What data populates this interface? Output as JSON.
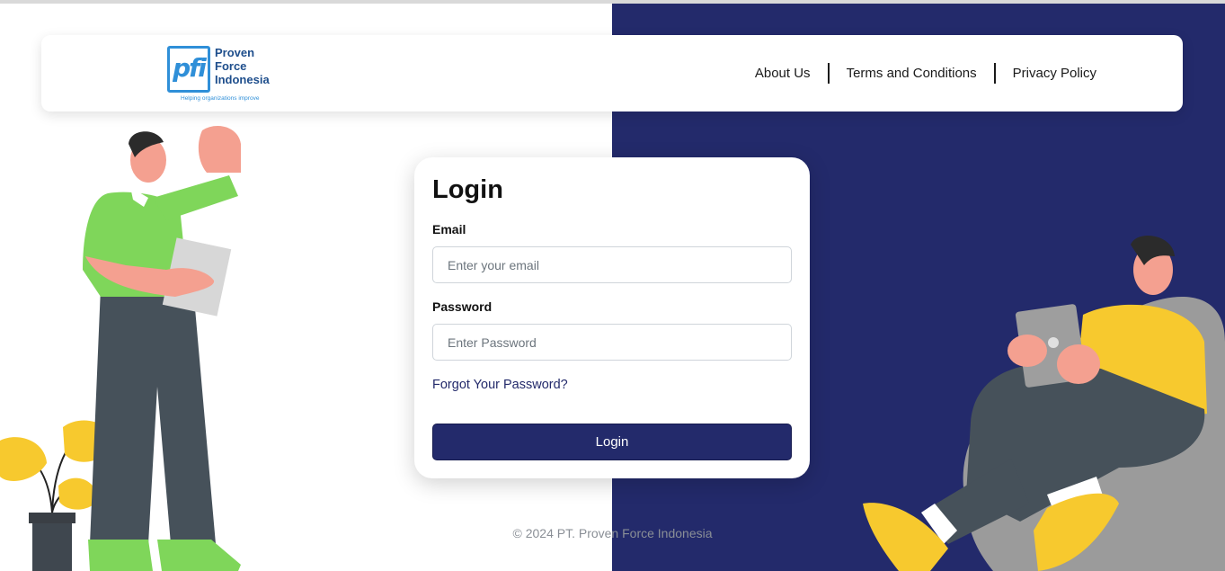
{
  "brand": {
    "mark": "pfi",
    "name_lines": [
      "Proven",
      "Force",
      "Indonesia"
    ],
    "tagline": "Helping organizations improve"
  },
  "nav": {
    "links": [
      "About Us",
      "Terms and Conditions",
      "Privacy Policy"
    ]
  },
  "login": {
    "title": "Login",
    "email_label": "Email",
    "email_placeholder": "Enter your email",
    "password_label": "Password",
    "password_placeholder": "Enter Password",
    "forgot_label": "Forgot Your Password?",
    "submit_label": "Login"
  },
  "footer": {
    "copyright": "© 2024 PT. Proven Force Indonesia"
  },
  "colors": {
    "primary": "#232a6b",
    "brand_blue": "#2f8fd8",
    "accent_green": "#7fd65a",
    "accent_yellow": "#f7c92e"
  }
}
